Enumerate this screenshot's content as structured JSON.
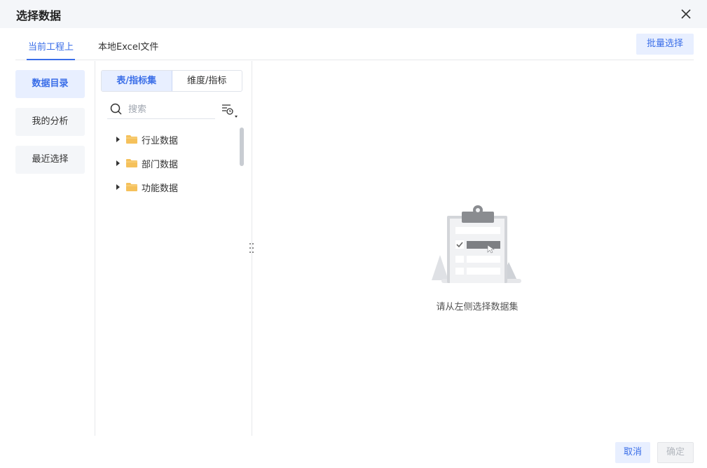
{
  "dialog": {
    "title": "选择数据"
  },
  "tabs": [
    {
      "label": "当前工程上",
      "active": true
    },
    {
      "label": "本地Excel文件",
      "active": false
    }
  ],
  "batch_select_label": "批量选择",
  "left_nav": [
    {
      "label": "数据目录",
      "active": true
    },
    {
      "label": "我的分析",
      "active": false
    },
    {
      "label": "最近选择",
      "active": false
    }
  ],
  "segment": [
    {
      "label": "表/指标集",
      "active": true
    },
    {
      "label": "维度/指标",
      "active": false
    }
  ],
  "search": {
    "placeholder": "搜索",
    "value": ""
  },
  "tree": [
    {
      "label": "行业数据",
      "icon": "folder-icon",
      "expanded": false
    },
    {
      "label": "部门数据",
      "icon": "folder-icon",
      "expanded": false
    },
    {
      "label": "功能数据",
      "icon": "folder-icon",
      "expanded": false
    }
  ],
  "empty_state": {
    "text": "请从左侧选择数据集"
  },
  "footer": {
    "cancel_label": "取消",
    "ok_label": "确定",
    "ok_disabled": true
  },
  "colors": {
    "accent": "#3a6ee8",
    "accent_bg": "#e8efff",
    "folder": "#f5c15b",
    "titlebar_bg": "#f4f6f9"
  }
}
